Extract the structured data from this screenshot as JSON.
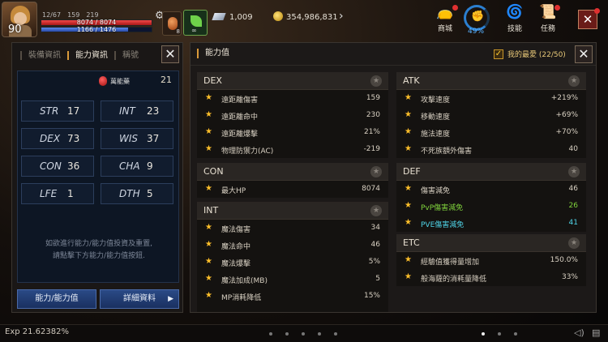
{
  "hud": {
    "level": "90",
    "buffs": [
      "12/67",
      "159",
      "219"
    ],
    "hp_text": "8074 / 8074",
    "hp_fill": 1.0,
    "mp_text": "1166 / 1476",
    "mp_fill": 0.79,
    "potion_count": "8",
    "leaf_count": "∞",
    "crystals": "1,009",
    "gold": "354,986,831",
    "shop_label": "商城",
    "progress_pct": "49%",
    "skills_label": "技能",
    "quest_label": "任務",
    "close": "✕"
  },
  "left": {
    "tabs": [
      "裝備資訊",
      "能力資訊",
      "稱號"
    ],
    "close": "✕",
    "potion_label": "萬能藥",
    "potion_count": "21",
    "stats": [
      {
        "k": "STR",
        "v": "17"
      },
      {
        "k": "INT",
        "v": "23"
      },
      {
        "k": "DEX",
        "v": "73"
      },
      {
        "k": "WIS",
        "v": "37"
      },
      {
        "k": "CON",
        "v": "36"
      },
      {
        "k": "CHA",
        "v": "9"
      },
      {
        "k": "LFE",
        "v": "1"
      },
      {
        "k": "DTH",
        "v": "5"
      }
    ],
    "note_line1": "如欲進行能力/能力值投資及重置,",
    "note_line2": "請點擊下方能力/能力值按鈕.",
    "btn_ability": "能力/能力值",
    "btn_detail": "詳細資料"
  },
  "right": {
    "title": "能力值",
    "favorites": "我的最愛 (22/50)",
    "close": "✕",
    "dex": {
      "title": "DEX",
      "rows": [
        {
          "n": "遠距離傷害",
          "v": "159"
        },
        {
          "n": "遠距離命中",
          "v": "230"
        },
        {
          "n": "遠距離爆擊",
          "v": "21%"
        },
        {
          "n": "物理防禦力(AC)",
          "v": "-219"
        }
      ]
    },
    "con": {
      "title": "CON",
      "rows": [
        {
          "n": "最大HP",
          "v": "8074"
        }
      ]
    },
    "int": {
      "title": "INT",
      "rows": [
        {
          "n": "魔法傷害",
          "v": "34"
        },
        {
          "n": "魔法命中",
          "v": "46"
        },
        {
          "n": "魔法爆擊",
          "v": "5%"
        },
        {
          "n": "魔法加成(MB)",
          "v": "5"
        },
        {
          "n": "MP消耗降低",
          "v": "15%"
        }
      ]
    },
    "atk": {
      "title": "ATK",
      "rows": [
        {
          "n": "攻擊速度",
          "v": "+219%"
        },
        {
          "n": "移動速度",
          "v": "+69%"
        },
        {
          "n": "施法速度",
          "v": "+70%"
        },
        {
          "n": "不死族額外傷害",
          "v": "40"
        }
      ]
    },
    "def": {
      "title": "DEF",
      "rows": [
        {
          "n": "傷害減免",
          "v": "46"
        },
        {
          "n": "PvP傷害減免",
          "v": "26"
        },
        {
          "n": "PVE傷害減免",
          "v": "41"
        }
      ]
    },
    "etc": {
      "title": "ETC",
      "rows": [
        {
          "n": "經驗值獲得量增加",
          "v": "150.0%"
        },
        {
          "n": "般海薩的消耗量降低",
          "v": "33%"
        }
      ]
    }
  },
  "bottom": {
    "exp": "Exp  21.62382%"
  }
}
